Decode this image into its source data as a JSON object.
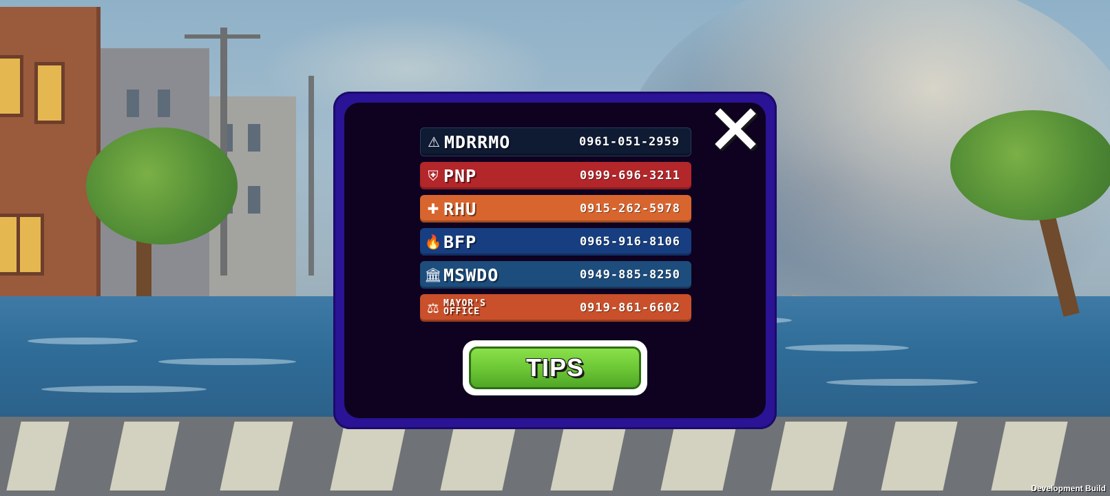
{
  "background": {
    "scene": "flooded-street-storm"
  },
  "dialog": {
    "close": {
      "icon": "close-icon"
    },
    "contacts": [
      {
        "name": "MDRRMO",
        "number": "0961-051-2959",
        "icon": "warning-icon",
        "glyph": "⚠",
        "color": "#0f1a33",
        "small": false
      },
      {
        "name": "PNP",
        "number": "0999-696-3211",
        "icon": "police-badge-icon",
        "glyph": "⛨",
        "color": "#b3262a",
        "small": false
      },
      {
        "name": "RHU",
        "number": "0915-262-5978",
        "icon": "medical-cross-icon",
        "glyph": "✚",
        "color": "#d9652e",
        "small": false
      },
      {
        "name": "BFP",
        "number": "0965-916-8106",
        "icon": "fire-icon",
        "glyph": "🔥",
        "color": "#173e80",
        "small": false
      },
      {
        "name": "MSWDO",
        "number": "0949-885-8250",
        "icon": "building-icon",
        "glyph": "🏛",
        "color": "#1d4d7d",
        "small": false
      },
      {
        "name": "MAYOR'S OFFICE",
        "number": "0919-861-6602",
        "icon": "gavel-icon",
        "glyph": "⚖",
        "color": "#c9502a",
        "small": true
      }
    ],
    "tips_label": "TIPS"
  },
  "footer": {
    "build_label": "Development Build"
  }
}
